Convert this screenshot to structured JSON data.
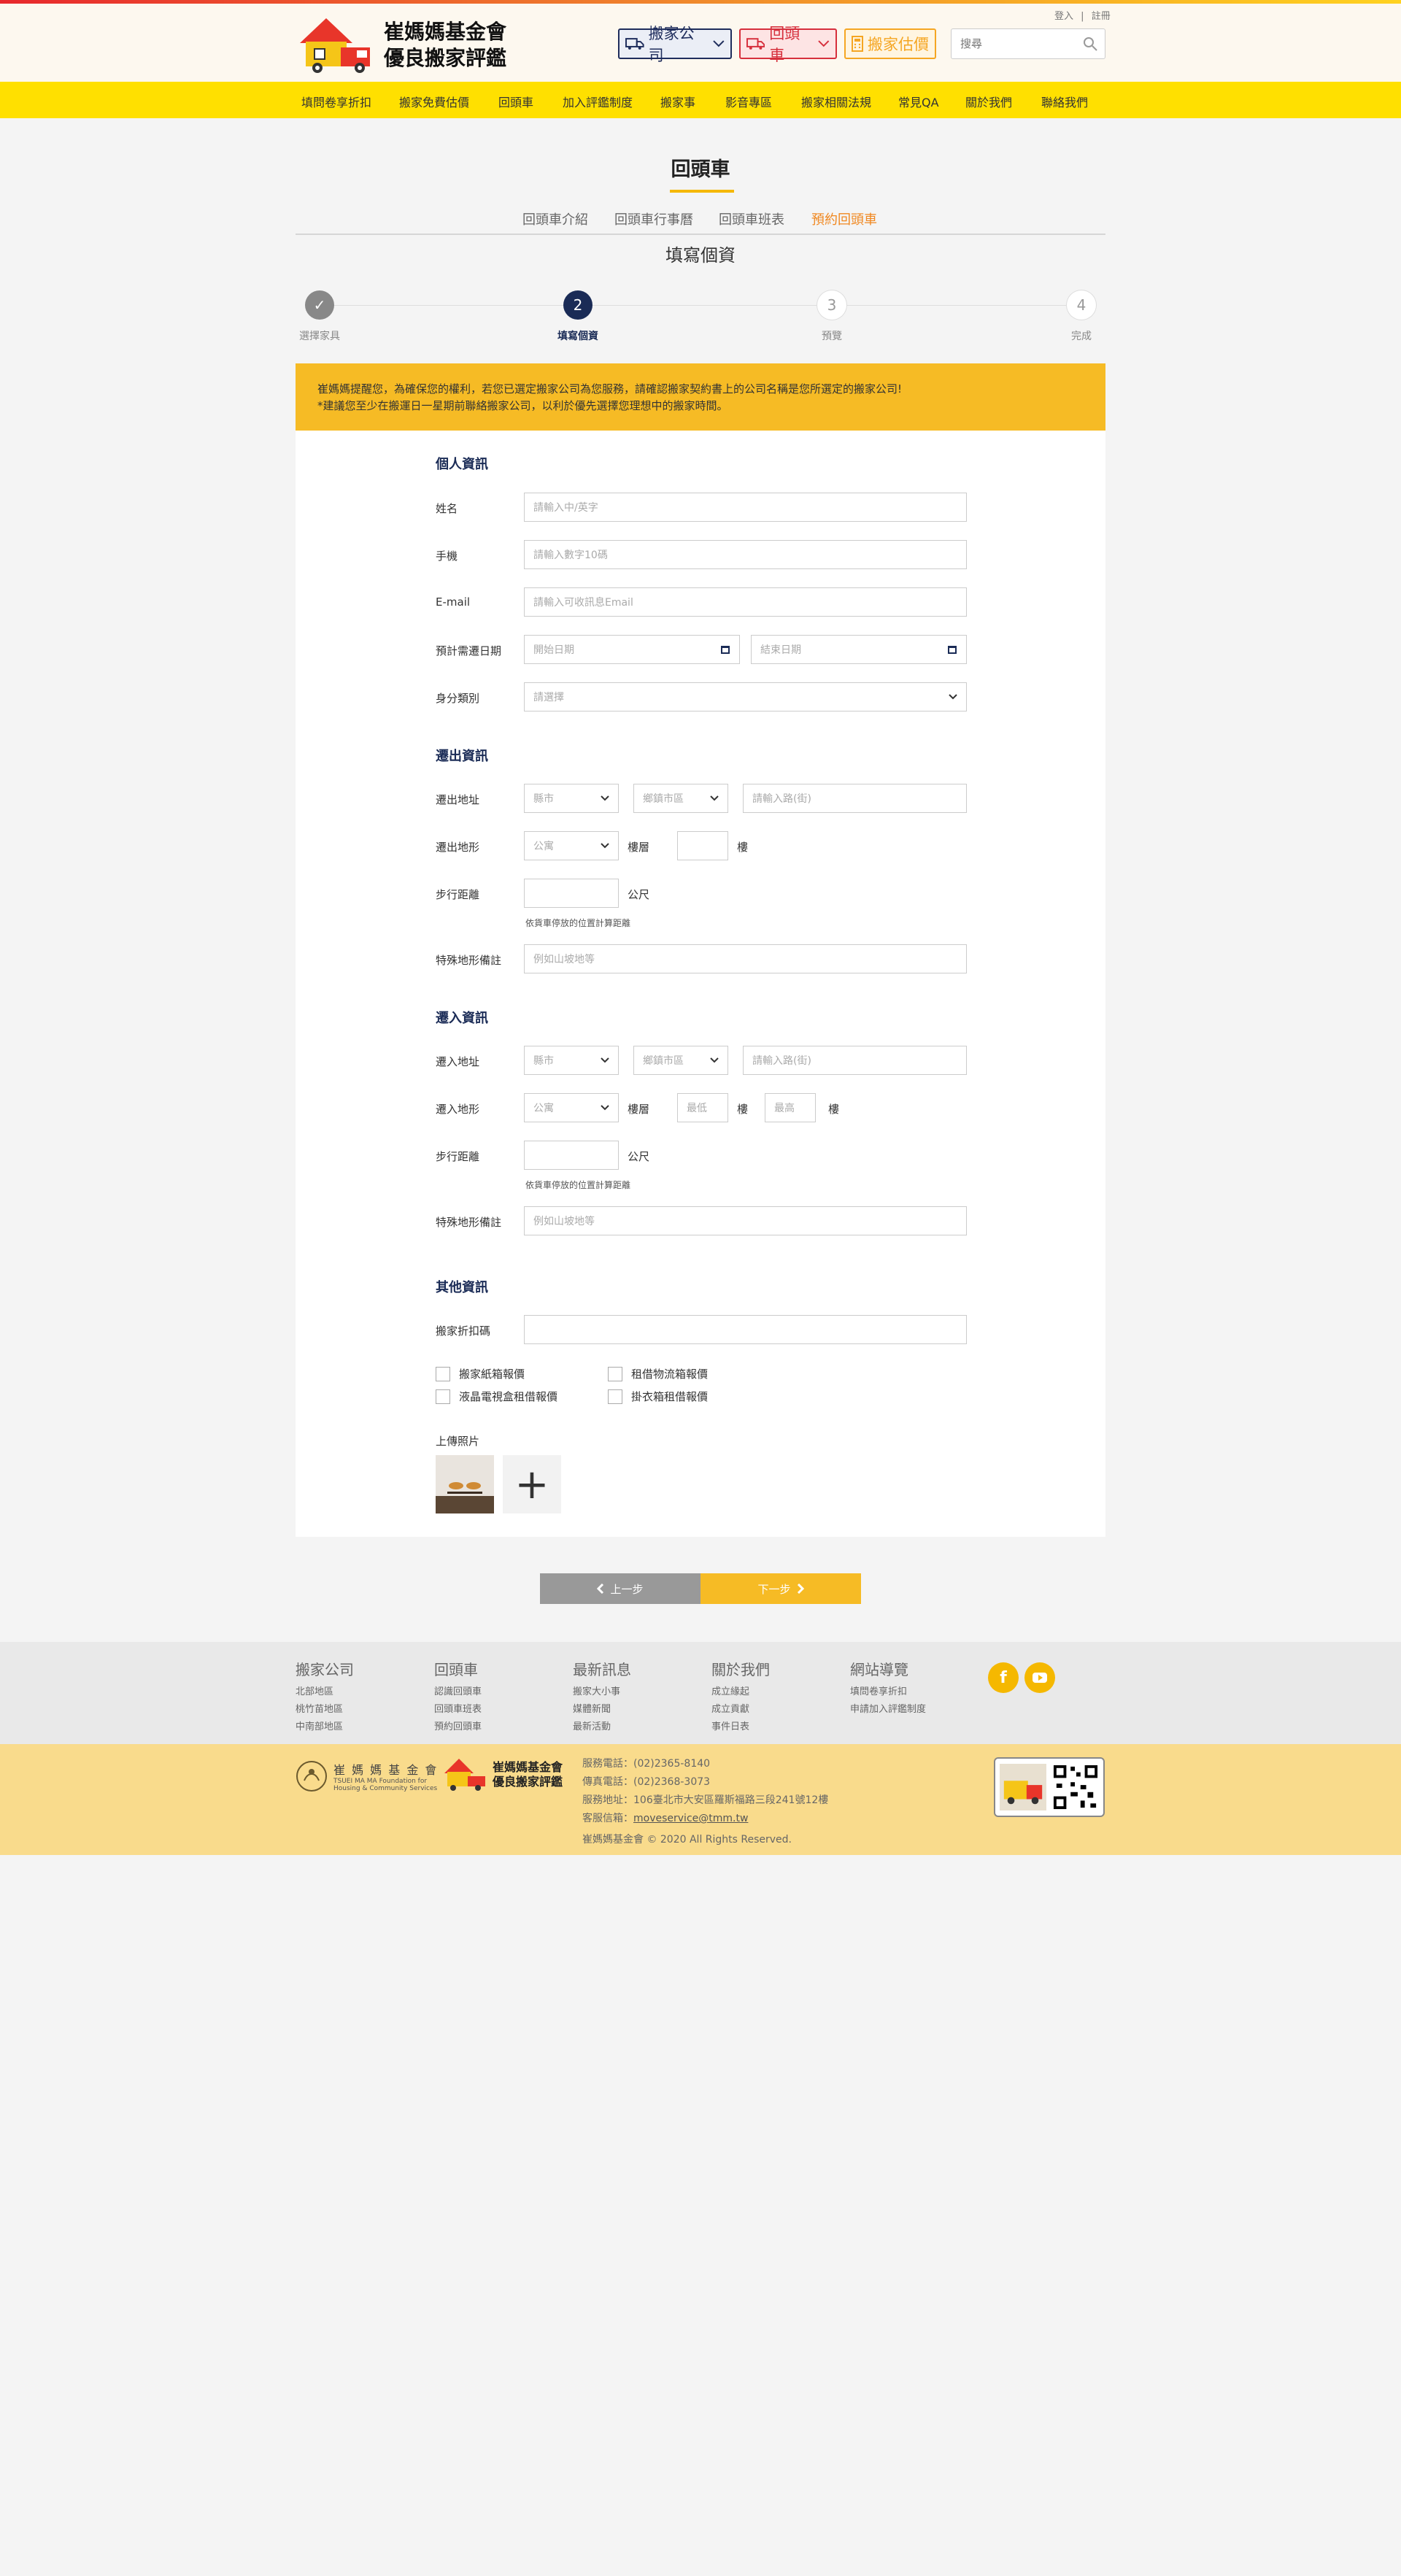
{
  "header": {
    "logo_line1": "崔媽媽基金會",
    "logo_line2": "優良搬家評鑑",
    "login": "登入",
    "separator": "|",
    "register": "註冊",
    "btn_moving_company": "搬家公司",
    "btn_return_truck": "回頭車",
    "btn_estimate": "搬家估價",
    "search_placeholder": "搜尋"
  },
  "nav": [
    "填問卷享折扣",
    "搬家免費估價",
    "回頭車",
    "加入評鑑制度",
    "搬家事",
    "影音專區",
    "搬家相關法規",
    "常見QA",
    "關於我們",
    "聯絡我們"
  ],
  "page_title": "回頭車",
  "subnav": [
    "回頭車介紹",
    "回頭車行事曆",
    "回頭車班表",
    "預約回頭車"
  ],
  "step_title": "填寫個資",
  "steps": [
    {
      "num": "✓",
      "label": "選擇家具"
    },
    {
      "num": "2",
      "label": "填寫個資"
    },
    {
      "num": "3",
      "label": "預覽"
    },
    {
      "num": "4",
      "label": "完成"
    }
  ],
  "notice": {
    "line1": "崔媽媽提醒您，為確保您的權利，若您已選定搬家公司為您服務，請確認搬家契約書上的公司名稱是您所選定的搬家公司!",
    "line2": "*建議您至少在搬運日一星期前聯絡搬家公司，以利於優先選擇您理想中的搬家時間。"
  },
  "personal": {
    "title": "個人資訊",
    "name_label": "姓名",
    "name_ph": "請輸入中/英字",
    "phone_label": "手機",
    "phone_ph": "請輸入數字10碼",
    "email_label": "E-mail",
    "email_ph": "請輸入可收訊息Email",
    "date_label": "預計需遷日期",
    "date_start_ph": "開始日期",
    "date_end_ph": "結束日期",
    "identity_label": "身分類別",
    "identity_ph": "請選擇"
  },
  "out": {
    "title": "遷出資訊",
    "addr_label": "遷出地址",
    "city_ph": "縣市",
    "district_ph": "鄉鎮市區",
    "road_ph": "請輸入路(街)",
    "terrain_label": "遷出地形",
    "terrain_ph": "公寓",
    "floor_label": "樓層",
    "floor_unit": "樓",
    "walk_label": "步行距離",
    "walk_unit": "公尺",
    "walk_hint": "依貨車停放的位置計算距離",
    "note_label": "特殊地形備註",
    "note_ph": "例如山坡地等"
  },
  "in": {
    "title": "遷入資訊",
    "addr_label": "遷入地址",
    "city_ph": "縣市",
    "district_ph": "鄉鎮市區",
    "road_ph": "請輸入路(街)",
    "terrain_label": "遷入地形",
    "terrain_ph": "公寓",
    "floor_label": "樓層",
    "floor_min_ph": "最低",
    "floor_max_ph": "最高",
    "floor_unit": "樓",
    "walk_label": "步行距離",
    "walk_unit": "公尺",
    "walk_hint": "依貨車停放的位置計算距離",
    "note_label": "特殊地形備註",
    "note_ph": "例如山坡地等"
  },
  "other": {
    "title": "其他資訊",
    "discount_label": "搬家折扣碼",
    "checks": [
      "搬家紙箱報價",
      "租借物流箱報價",
      "液晶電視盒租借報價",
      "掛衣箱租借報價"
    ],
    "upload_label": "上傳照片",
    "plus": "+"
  },
  "buttons": {
    "prev": "上一步",
    "next": "下一步"
  },
  "footer": {
    "cols": [
      {
        "title": "搬家公司",
        "items": [
          "北部地區",
          "桃竹苗地區",
          "中南部地區"
        ]
      },
      {
        "title": "回頭車",
        "items": [
          "認識回頭車",
          "回頭車班表",
          "預約回頭車"
        ]
      },
      {
        "title": "最新訊息",
        "items": [
          "搬家大小事",
          "媒體新聞",
          "最新活動"
        ]
      },
      {
        "title": "關於我們",
        "items": [
          "成立緣起",
          "成立貢獻",
          "事件日表"
        ]
      },
      {
        "title": "網站導覽",
        "items": [
          "填問卷享折扣",
          "申請加入評鑑制度"
        ]
      }
    ],
    "foundation_name": "崔 媽 媽 基 金 會",
    "foundation_en1": "TSUEI MA MA Foundation for",
    "foundation_en2": "Housing & Community Services",
    "logo_line1": "崔媽媽基金會",
    "logo_line2": "優良搬家評鑑",
    "phone": "服務電話：(02)2365-8140",
    "fax": "傳真電話：(02)2368-3073",
    "address": "服務地址：106臺北市大安區羅斯福路三段241號12樓",
    "email_label": "客服信箱：",
    "email": "moveservice@tmm.tw",
    "copyright": "崔媽媽基金會 © 2020 All Rights Reserved."
  }
}
